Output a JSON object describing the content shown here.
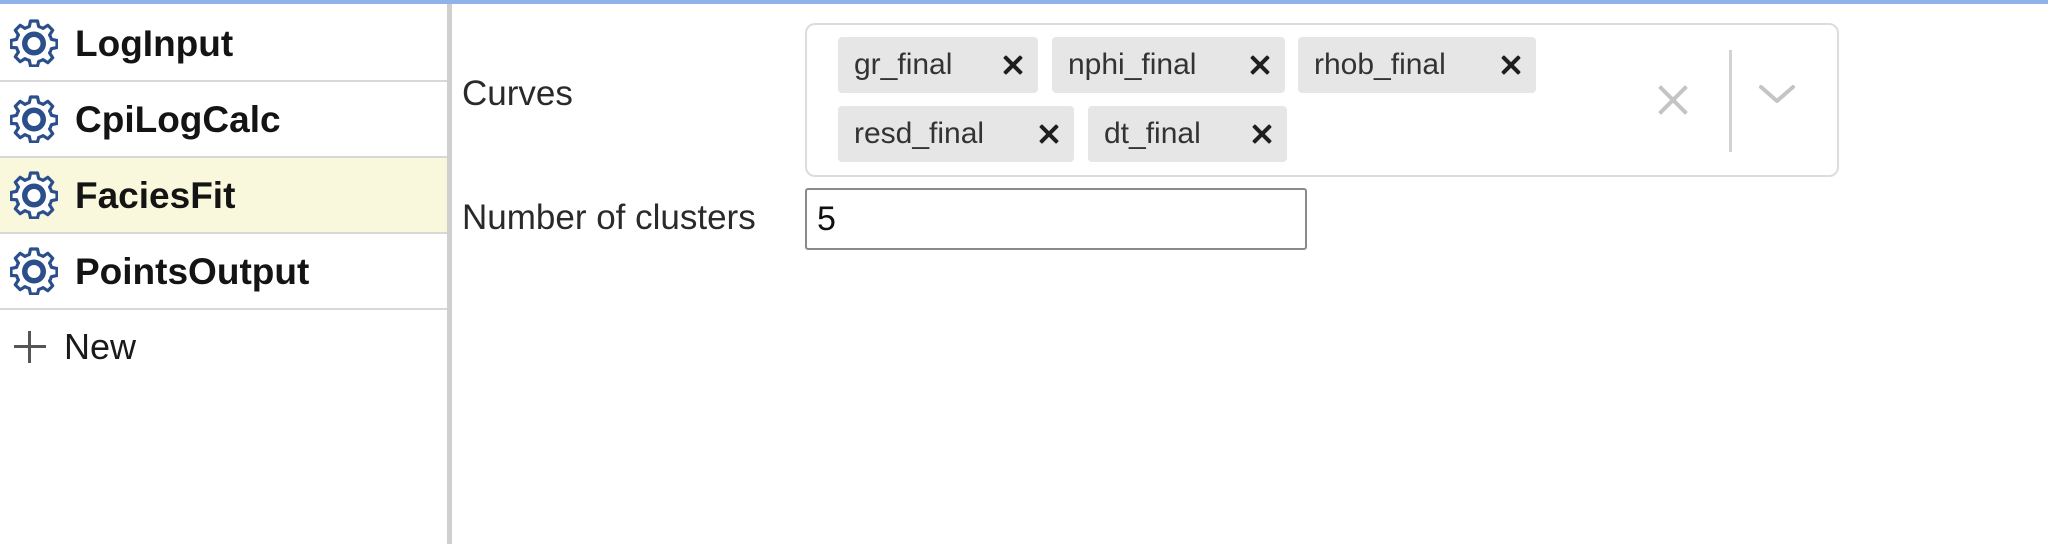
{
  "sidebar": {
    "items": [
      {
        "label": "LogInput",
        "icon": "gear-icon",
        "selected": false
      },
      {
        "label": "CpiLogCalc",
        "icon": "gear-icon",
        "selected": false
      },
      {
        "label": "FaciesFit",
        "icon": "gear-icon",
        "selected": true
      },
      {
        "label": "PointsOutput",
        "icon": "gear-icon",
        "selected": false
      }
    ],
    "new_label": "New",
    "new_icon": "plus-icon"
  },
  "form": {
    "curves": {
      "label": "Curves",
      "selected": [
        "gr_final",
        "nphi_final",
        "rhob_final",
        "resd_final",
        "dt_final"
      ]
    },
    "clusters": {
      "label": "Number of clusters",
      "value": "5"
    }
  },
  "colors": {
    "selected_row_bg": "#f9f8dc",
    "gear_icon": "#2b4f8a",
    "chip_bg": "#e6e6e6",
    "top_accent": "#8fb3e8"
  }
}
